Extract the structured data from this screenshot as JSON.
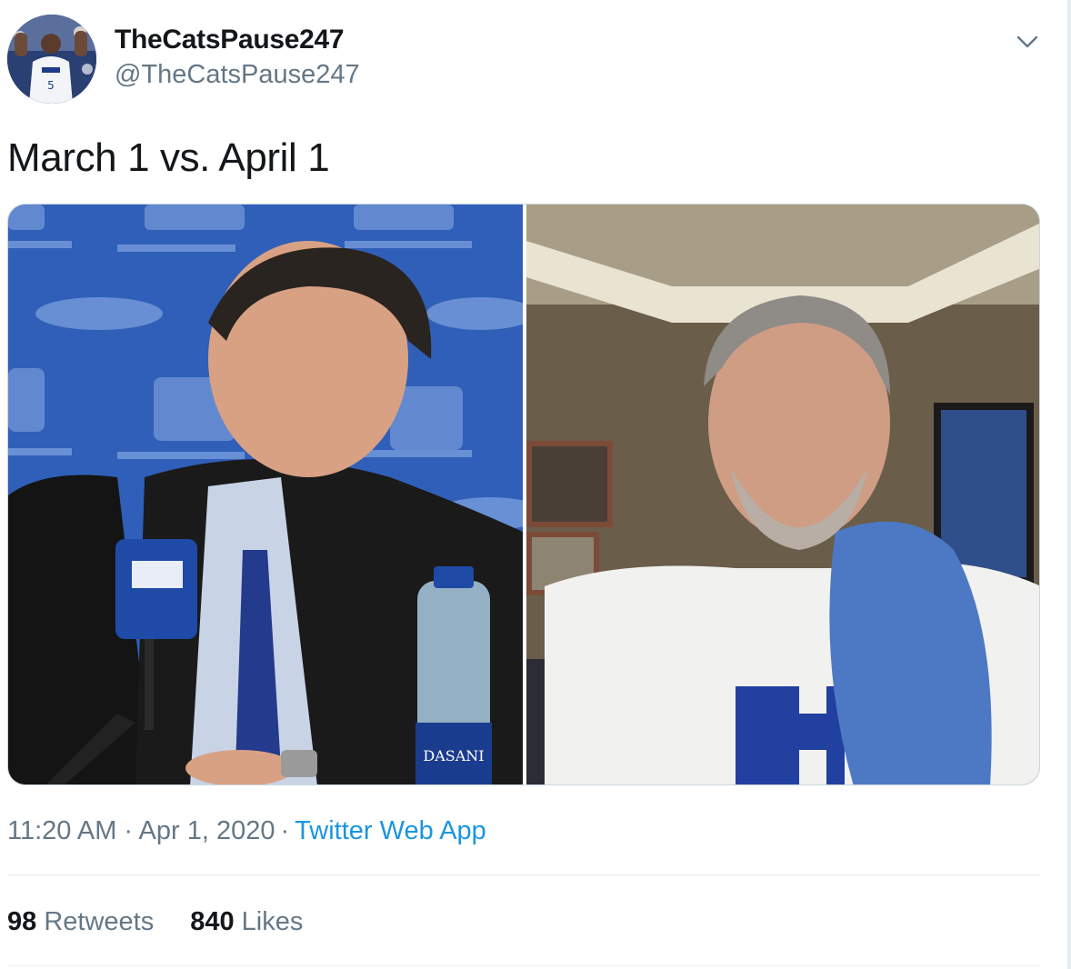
{
  "tweet": {
    "author": {
      "display_name": "TheCatsPause247",
      "handle": "@TheCatsPause247",
      "avatar_icon": "avatar-image"
    },
    "menu_icon": "chevron-down-icon",
    "text": "March 1 vs. April 1",
    "media": {
      "left_photo_icon": "press-conference-photo",
      "right_photo_icon": "home-video-photo"
    },
    "timestamp": "11:20 AM · Apr 1, 2020",
    "separator": "·",
    "source": "Twitter Web App",
    "stats": {
      "retweets_count": "98",
      "retweets_label": "Retweets",
      "likes_count": "840",
      "likes_label": "Likes"
    }
  },
  "colors": {
    "primary_text": "#14171a",
    "secondary_text": "#657786",
    "link": "#1b95e0",
    "border": "#e6ecf0"
  }
}
